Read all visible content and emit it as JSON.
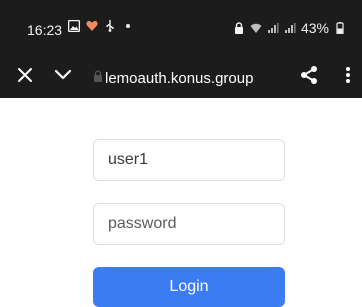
{
  "status_bar": {
    "time": "16:23",
    "battery_percent": "43%",
    "icons_left": [
      "image-icon",
      "heart-icon",
      "usb-icon",
      "dot-icon"
    ],
    "icons_right": [
      "lock-icon",
      "wifi-icon",
      "signal-icon",
      "signal-icon",
      "battery-icon"
    ]
  },
  "toolbar": {
    "url": "lemoauth.konus.group"
  },
  "login_form": {
    "username_value": "user1",
    "password_placeholder": "password",
    "login_label": "Login"
  },
  "colors": {
    "topbar_bg": "#1c1c1c",
    "accent": "#3b7cf2"
  }
}
